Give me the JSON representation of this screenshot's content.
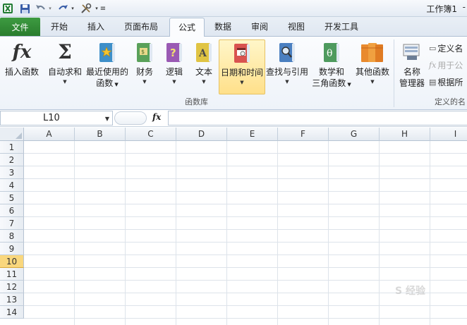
{
  "window": {
    "title": "工作簿1",
    "dash": "-"
  },
  "tabs": {
    "file": "文件",
    "items": [
      {
        "label": "开始"
      },
      {
        "label": "插入"
      },
      {
        "label": "页面布局"
      },
      {
        "label": "公式",
        "active": true
      },
      {
        "label": "数据"
      },
      {
        "label": "审阅"
      },
      {
        "label": "视图"
      },
      {
        "label": "开发工具"
      }
    ]
  },
  "ribbon": {
    "insert_function": "插入函数",
    "autosum": "自动求和",
    "recent_line1": "最近使用的",
    "recent_line2": "函数",
    "financial": "财务",
    "logical": "逻辑",
    "text": "文本",
    "datetime": "日期和时间",
    "lookup": "查找与引用",
    "math_line1": "数学和",
    "math_line2": "三角函数",
    "more": "其他函数",
    "group_library": "函数库",
    "name_manager_line1": "名称",
    "name_manager_line2": "管理器",
    "define_name": "定义名",
    "use_in_formula": "用于公",
    "create_from_selection": "根据所",
    "group_names": "定义的名"
  },
  "formula_bar": {
    "name_box": "L10",
    "fx": "fx",
    "formula": ""
  },
  "grid": {
    "columns": [
      "A",
      "B",
      "C",
      "D",
      "E",
      "F",
      "G",
      "H",
      "I"
    ],
    "rows": [
      "1",
      "2",
      "3",
      "4",
      "5",
      "6",
      "7",
      "8",
      "9",
      "10",
      "11",
      "12",
      "13",
      "14"
    ],
    "selected_row": "10",
    "selection_color": "#f9d77d"
  },
  "watermark": "S 经验"
}
